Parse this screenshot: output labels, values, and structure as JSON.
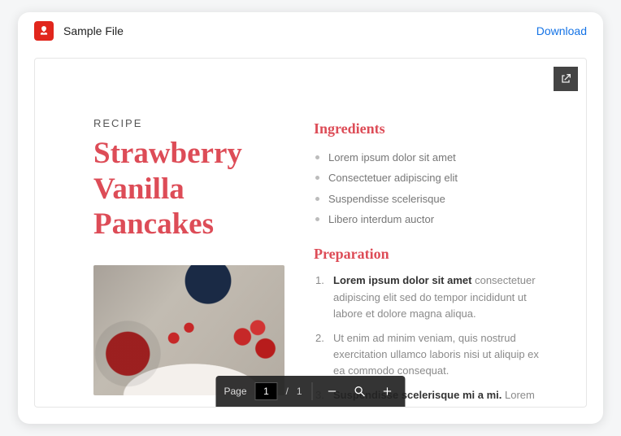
{
  "header": {
    "file_title": "Sample File",
    "download_label": "Download"
  },
  "document": {
    "eyebrow": "RECIPE",
    "title": "Strawberry Vanilla Pancakes",
    "sections": {
      "ingredients_heading": "Ingredients",
      "ingredients": [
        "Lorem ipsum dolor sit amet",
        "Consectetuer adipiscing elit",
        "Suspendisse scelerisque",
        "Libero interdum auctor"
      ],
      "preparation_heading": "Preparation",
      "preparation": [
        {
          "lead": "Lorem ipsum dolor sit amet",
          "rest": " consectetuer adipiscing elit sed do tempor incididunt ut labore et dolore magna aliqua."
        },
        {
          "lead": "",
          "rest": "Ut enim ad minim veniam, quis nostrud exercitation ullamco laboris nisi ut aliquip ex ea commodo consequat."
        },
        {
          "lead": "Suspendisse scelerisque mi a mi.",
          "rest": " Lorem ipsum dolor sit amet, consectetuer"
        }
      ]
    }
  },
  "pager": {
    "page_label": "Page",
    "current": "1",
    "separator": "/",
    "total": "1"
  }
}
